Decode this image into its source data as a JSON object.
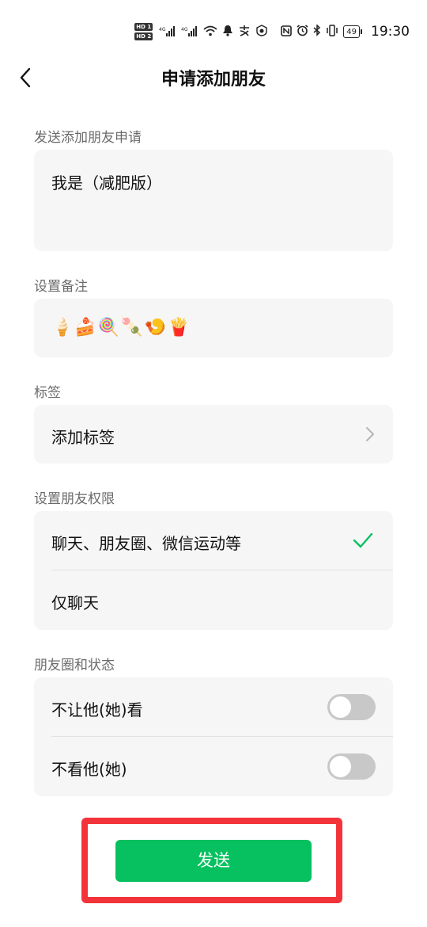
{
  "status_bar": {
    "hd1": "HD 1",
    "hd2": "HD 2",
    "signal1": "4G",
    "signal2": "4G",
    "battery": "49",
    "time": "19:30"
  },
  "header": {
    "title": "申请添加朋友"
  },
  "message_section": {
    "label": "发送添加朋友申请",
    "text": "我是（减肥版）"
  },
  "remark_section": {
    "label": "设置备注",
    "text": "🍦🍰🍭🍡🍤🍟"
  },
  "tag_section": {
    "label": "标签",
    "row_label": "添加标签"
  },
  "permission_section": {
    "label": "设置朋友权限",
    "options": [
      {
        "label": "聊天、朋友圈、微信运动等",
        "selected": true
      },
      {
        "label": "仅聊天",
        "selected": false
      }
    ]
  },
  "moments_section": {
    "label": "朋友圈和状态",
    "toggles": [
      {
        "label": "不让他(她)看",
        "on": false
      },
      {
        "label": "不看他(她)",
        "on": false
      }
    ]
  },
  "send_button": {
    "label": "发送"
  },
  "colors": {
    "accent": "#07c160",
    "highlight": "#f2333a",
    "card_bg": "#f6f6f6"
  }
}
